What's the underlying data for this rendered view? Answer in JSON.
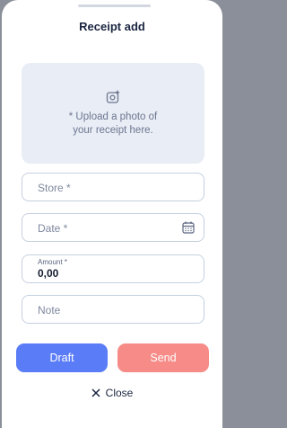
{
  "header": {
    "title": "Receipt add"
  },
  "upload": {
    "icon": "add-photo-icon",
    "text": "* Upload a photo of\nyour receipt here."
  },
  "form": {
    "store_placeholder": "Store *",
    "date_placeholder": "Date *",
    "date_icon": "calendar-icon",
    "amount_label": "Amount *",
    "amount_value": "0,00",
    "note_placeholder": "Note"
  },
  "actions": {
    "draft_label": "Draft",
    "send_label": "Send",
    "close_label": "Close",
    "close_icon": "close-icon"
  },
  "colors": {
    "draft": "#5a7cf6",
    "send": "#f68b87",
    "upload_bg": "#e9edf5",
    "field_border": "#c4d0e0"
  }
}
